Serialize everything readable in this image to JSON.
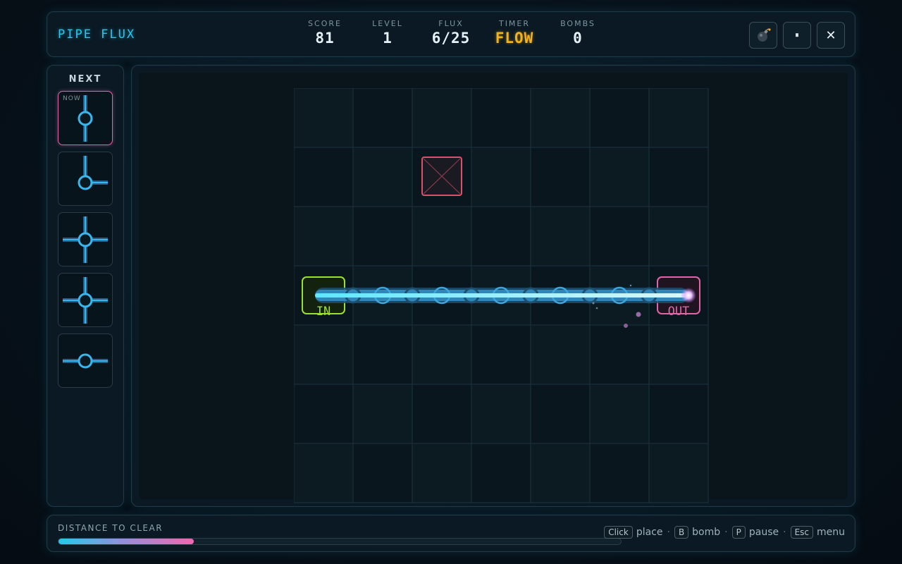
{
  "header": {
    "title": "PIPE FLUX",
    "stats": [
      {
        "label": "SCORE",
        "value": "81"
      },
      {
        "label": "LEVEL",
        "value": "1"
      },
      {
        "label": "FLUX",
        "value": "6/25"
      },
      {
        "label": "TIMER",
        "value": "FLOW"
      },
      {
        "label": "BOMBS",
        "value": "0"
      }
    ],
    "buttons": {
      "bomb_icon": "bomb-icon",
      "pause_label": "⏸",
      "close_label": "✕"
    }
  },
  "queue": {
    "label": "NEXT",
    "now_tag": "NOW",
    "pieces": [
      "vertical",
      "elbow-down-right",
      "cross",
      "cross",
      "horizontal"
    ]
  },
  "board": {
    "cols": 7,
    "rows": 7,
    "start_label": "IN",
    "end_label": "OUT",
    "blocked_cells": [
      [
        2,
        1
      ]
    ],
    "flow_row": 3,
    "colors": {
      "pipe": "#2aa8e6",
      "flow": "#25d7f0",
      "start": "#9be02c",
      "end": "#e064a8",
      "blocked": "#d8526a"
    }
  },
  "footer": {
    "distance_label": "DISTANCE TO CLEAR",
    "distance_fraction": 0.24,
    "hints": [
      {
        "key": "Click",
        "action": "place"
      },
      {
        "key": "B",
        "action": "bomb"
      },
      {
        "key": "P",
        "action": "pause"
      },
      {
        "key": "Esc",
        "action": "menu"
      }
    ]
  }
}
